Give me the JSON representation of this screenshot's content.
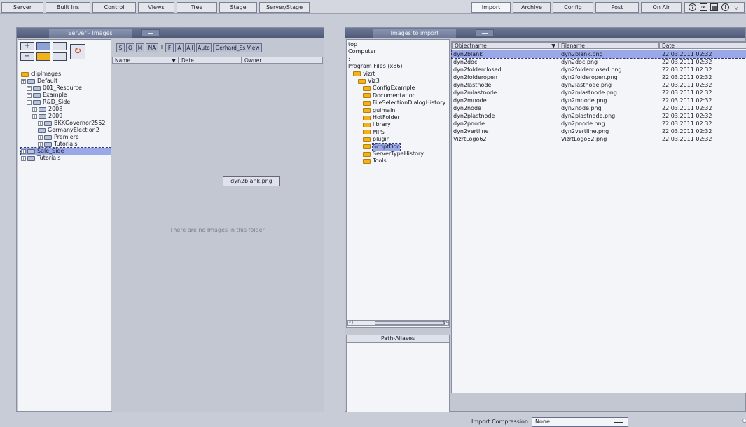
{
  "menubar": {
    "items": [
      "Server",
      "Built Ins",
      "Control",
      "Views",
      "Tree",
      "Stage",
      "Server/Stage",
      "Import",
      "Archive",
      "Config",
      "Post",
      "On Air"
    ],
    "icons": [
      "help-icon",
      "mail-icon",
      "calendar-icon",
      "info-icon",
      "dropdown-icon"
    ]
  },
  "left_panel": {
    "title": "Server - Images",
    "filter_buttons": [
      "S",
      "O",
      "M",
      "NA",
      "I",
      "F",
      "A",
      "All",
      "Auto",
      "Gerhard_Ss View"
    ],
    "tree": [
      {
        "label": "clipImages",
        "depth": 0,
        "expander": false,
        "color": "yellow"
      },
      {
        "label": "Default",
        "depth": 0,
        "expander": true,
        "color": "blue"
      },
      {
        "label": "001_Resource",
        "depth": 1,
        "expander": true,
        "color": "blue"
      },
      {
        "label": "Example",
        "depth": 1,
        "expander": true,
        "color": "blue"
      },
      {
        "label": "R&D_Side",
        "depth": 1,
        "expander": true,
        "color": "blue"
      },
      {
        "label": "2008",
        "depth": 2,
        "expander": true,
        "color": "blue"
      },
      {
        "label": "2009",
        "depth": 2,
        "expander": true,
        "color": "blue"
      },
      {
        "label": "BKKGovernor2552",
        "depth": 3,
        "expander": true,
        "color": "blue"
      },
      {
        "label": "GermanyElection2",
        "depth": 3,
        "expander": false,
        "color": "blue"
      },
      {
        "label": "Premiere",
        "depth": 3,
        "expander": true,
        "color": "blue"
      },
      {
        "label": "Tutorials",
        "depth": 3,
        "expander": true,
        "color": "blue"
      },
      {
        "label": "Sale_Side",
        "depth": 0,
        "expander": true,
        "color": "blue",
        "selected": true
      },
      {
        "label": "Tutorials",
        "depth": 0,
        "expander": true,
        "color": "blue"
      }
    ],
    "columns": {
      "name": "Name",
      "date": "Date",
      "owner": "Owner"
    },
    "drag_label": "dyn2blank.png",
    "empty_message": "There are no Images in this folder."
  },
  "right_panel": {
    "title": "Images to import",
    "dir_tree": [
      {
        "label": "top",
        "depth": 0,
        "folder": false
      },
      {
        "label": "Computer",
        "depth": 0,
        "folder": false
      },
      {
        "label": ":",
        "depth": 0,
        "folder": false
      },
      {
        "label": "Program Files (x86)",
        "depth": 0,
        "folder": false
      },
      {
        "label": "vizrt",
        "depth": 1,
        "folder": true
      },
      {
        "label": "Viz3",
        "depth": 2,
        "folder": true
      },
      {
        "label": "ConfigExample",
        "depth": 3,
        "folder": true
      },
      {
        "label": "Documentation",
        "depth": 3,
        "folder": true
      },
      {
        "label": "FileSelectionDialogHistory",
        "depth": 3,
        "folder": true
      },
      {
        "label": "guimain",
        "depth": 3,
        "folder": true
      },
      {
        "label": "HotFolder",
        "depth": 3,
        "folder": true
      },
      {
        "label": "library",
        "depth": 3,
        "folder": true
      },
      {
        "label": "MPS",
        "depth": 3,
        "folder": true
      },
      {
        "label": "plugin",
        "depth": 3,
        "folder": true
      },
      {
        "label": "ScriptDoc",
        "depth": 3,
        "folder": true,
        "selected": true
      },
      {
        "label": "ServerTypeHistory",
        "depth": 3,
        "folder": true
      },
      {
        "label": "Tools",
        "depth": 3,
        "folder": true
      }
    ],
    "path_aliases_label": "Path-Aliases",
    "columns": {
      "objectname": "Objectname",
      "filename": "Filename",
      "date": "Date"
    },
    "files": [
      {
        "objectname": "dyn2blank",
        "filename": "dyn2blank.png",
        "date": "22.03.2011 02:32",
        "selected": true
      },
      {
        "objectname": "dyn2doc",
        "filename": "dyn2doc.png",
        "date": "22.03.2011 02:32"
      },
      {
        "objectname": "dyn2folderclosed",
        "filename": "dyn2folderclosed.png",
        "date": "22.03.2011 02:32"
      },
      {
        "objectname": "dyn2folderopen",
        "filename": "dyn2folderopen.png",
        "date": "22.03.2011 02:32"
      },
      {
        "objectname": "dyn2lastnode",
        "filename": "dyn2lastnode.png",
        "date": "22.03.2011 02:32"
      },
      {
        "objectname": "dyn2mlastnode",
        "filename": "dyn2mlastnode.png",
        "date": "22.03.2011 02:32"
      },
      {
        "objectname": "dyn2mnode",
        "filename": "dyn2mnode.png",
        "date": "22.03.2011 02:32"
      },
      {
        "objectname": "dyn2node",
        "filename": "dyn2node.png",
        "date": "22.03.2011 02:32"
      },
      {
        "objectname": "dyn2plastnode",
        "filename": "dyn2plastnode.png",
        "date": "22.03.2011 02:32"
      },
      {
        "objectname": "dyn2pnode",
        "filename": "dyn2pnode.png",
        "date": "22.03.2011 02:32"
      },
      {
        "objectname": "dyn2vertline",
        "filename": "dyn2vertline.png",
        "date": "22.03.2011 02:32"
      },
      {
        "objectname": "VizrtLogo62",
        "filename": "VizrtLogo62.png",
        "date": "22.03.2011 02:32"
      }
    ],
    "compression_label": "Import Compression",
    "compression_value": "None"
  }
}
